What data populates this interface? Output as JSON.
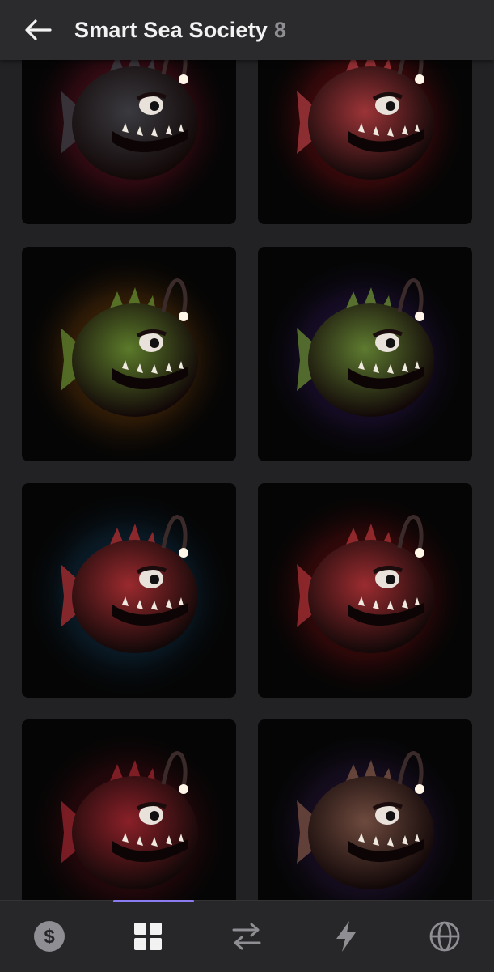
{
  "header": {
    "title": "Smart Sea Society",
    "count": "8"
  },
  "colors": {
    "background": "#222224",
    "header": "#2b2b2e",
    "active_indicator": "#8a7cf0"
  },
  "items": [
    {
      "name": "nft-1",
      "body": "#3a3a3f",
      "glow": "#6a1023"
    },
    {
      "name": "nft-2",
      "body": "#9c3438",
      "glow": "#7a0d12"
    },
    {
      "name": "nft-3",
      "body": "#5b7a2a",
      "glow": "#6a3a08"
    },
    {
      "name": "nft-4",
      "body": "#5e7b30",
      "glow": "#2b1550"
    },
    {
      "name": "nft-5",
      "body": "#9a2a2e",
      "glow": "#0f3550"
    },
    {
      "name": "nft-6",
      "body": "#9b2c30",
      "glow": "#6a0c0f"
    },
    {
      "name": "nft-7",
      "body": "#8a2028",
      "glow": "#4a0a12"
    },
    {
      "name": "nft-8",
      "body": "#6e4a3e",
      "glow": "#2a1640"
    }
  ],
  "nav": [
    {
      "icon": "dollar-icon",
      "active": false
    },
    {
      "icon": "grid-icon",
      "active": true
    },
    {
      "icon": "swap-arrows-icon",
      "active": false
    },
    {
      "icon": "lightning-icon",
      "active": false
    },
    {
      "icon": "globe-icon",
      "active": false
    }
  ]
}
